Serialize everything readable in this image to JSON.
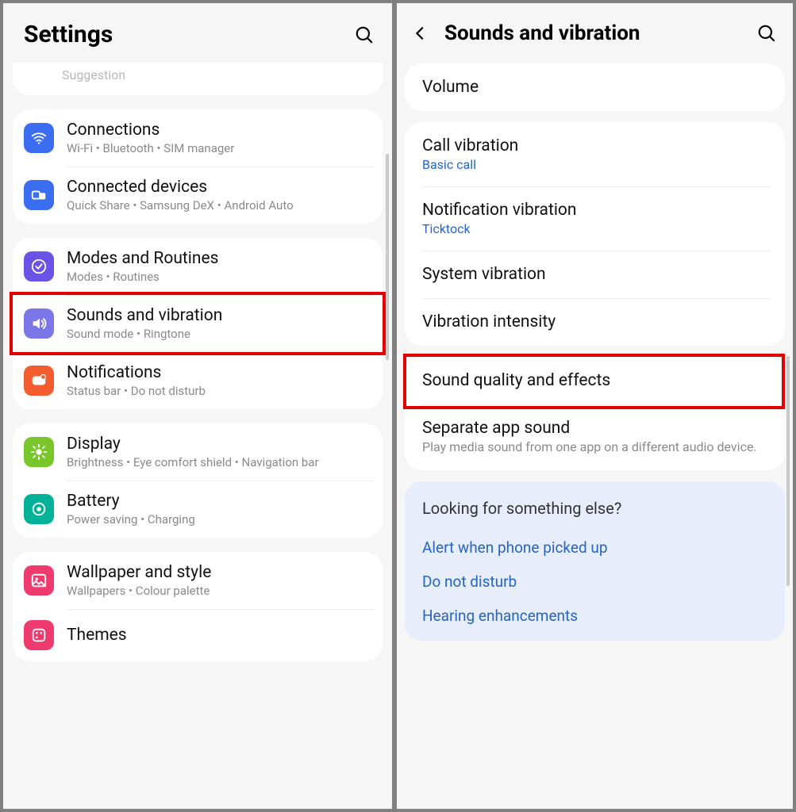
{
  "left": {
    "title": "Settings",
    "suggestion_label": "Suggestion",
    "groups": [
      {
        "items": [
          {
            "key": "connections",
            "title": "Connections",
            "sub": "Wi-Fi  •  Bluetooth  •  SIM manager",
            "color": "#3a6df0"
          },
          {
            "key": "devices",
            "title": "Connected devices",
            "sub": "Quick Share  •  Samsung DeX  •  Android Auto",
            "color": "#3a6df0"
          }
        ]
      },
      {
        "items": [
          {
            "key": "modes",
            "title": "Modes and Routines",
            "sub": "Modes  •  Routines",
            "color": "#6a53e6"
          },
          {
            "key": "sounds",
            "title": "Sounds and vibration",
            "sub": "Sound mode  •  Ringtone",
            "color": "#7b77e8",
            "highlight": true
          },
          {
            "key": "notif",
            "title": "Notifications",
            "sub": "Status bar  •  Do not disturb",
            "color": "#f25c2e"
          }
        ]
      },
      {
        "items": [
          {
            "key": "display",
            "title": "Display",
            "sub": "Brightness  •  Eye comfort shield  •  Navigation bar",
            "color": "#79c62b"
          },
          {
            "key": "battery",
            "title": "Battery",
            "sub": "Power saving  •  Charging",
            "color": "#00b297"
          }
        ]
      },
      {
        "items": [
          {
            "key": "wallpaper",
            "title": "Wallpaper and style",
            "sub": "Wallpapers  •  Colour palette",
            "color": "#ef3a6e"
          },
          {
            "key": "themes",
            "title": "Themes",
            "sub": "",
            "color": "#ef3a6e"
          }
        ]
      }
    ]
  },
  "right": {
    "title": "Sounds and vibration",
    "groups": [
      {
        "items": [
          {
            "key": "volume",
            "title": "Volume"
          }
        ]
      },
      {
        "items": [
          {
            "key": "callvib",
            "title": "Call vibration",
            "sub_blue": "Basic call"
          },
          {
            "key": "notifvib",
            "title": "Notification vibration",
            "sub_blue": "Ticktock"
          },
          {
            "key": "sysvib",
            "title": "System vibration"
          },
          {
            "key": "vibint",
            "title": "Vibration intensity"
          }
        ]
      },
      {
        "items": [
          {
            "key": "sqfx",
            "title": "Sound quality and effects",
            "highlight": true
          },
          {
            "key": "sepapp",
            "title": "Separate app sound",
            "sub": "Play media sound from one app on a different audio device."
          }
        ]
      }
    ],
    "suggest": {
      "heading": "Looking for something else?",
      "links": [
        "Alert when phone picked up",
        "Do not disturb",
        "Hearing enhancements"
      ]
    }
  },
  "icons": {
    "connections": "wifi",
    "devices": "mirror",
    "modes": "check-circle",
    "sounds": "speaker",
    "notif": "bell-dot",
    "display": "sun",
    "battery": "battery-ring",
    "wallpaper": "picture",
    "themes": "palette"
  }
}
